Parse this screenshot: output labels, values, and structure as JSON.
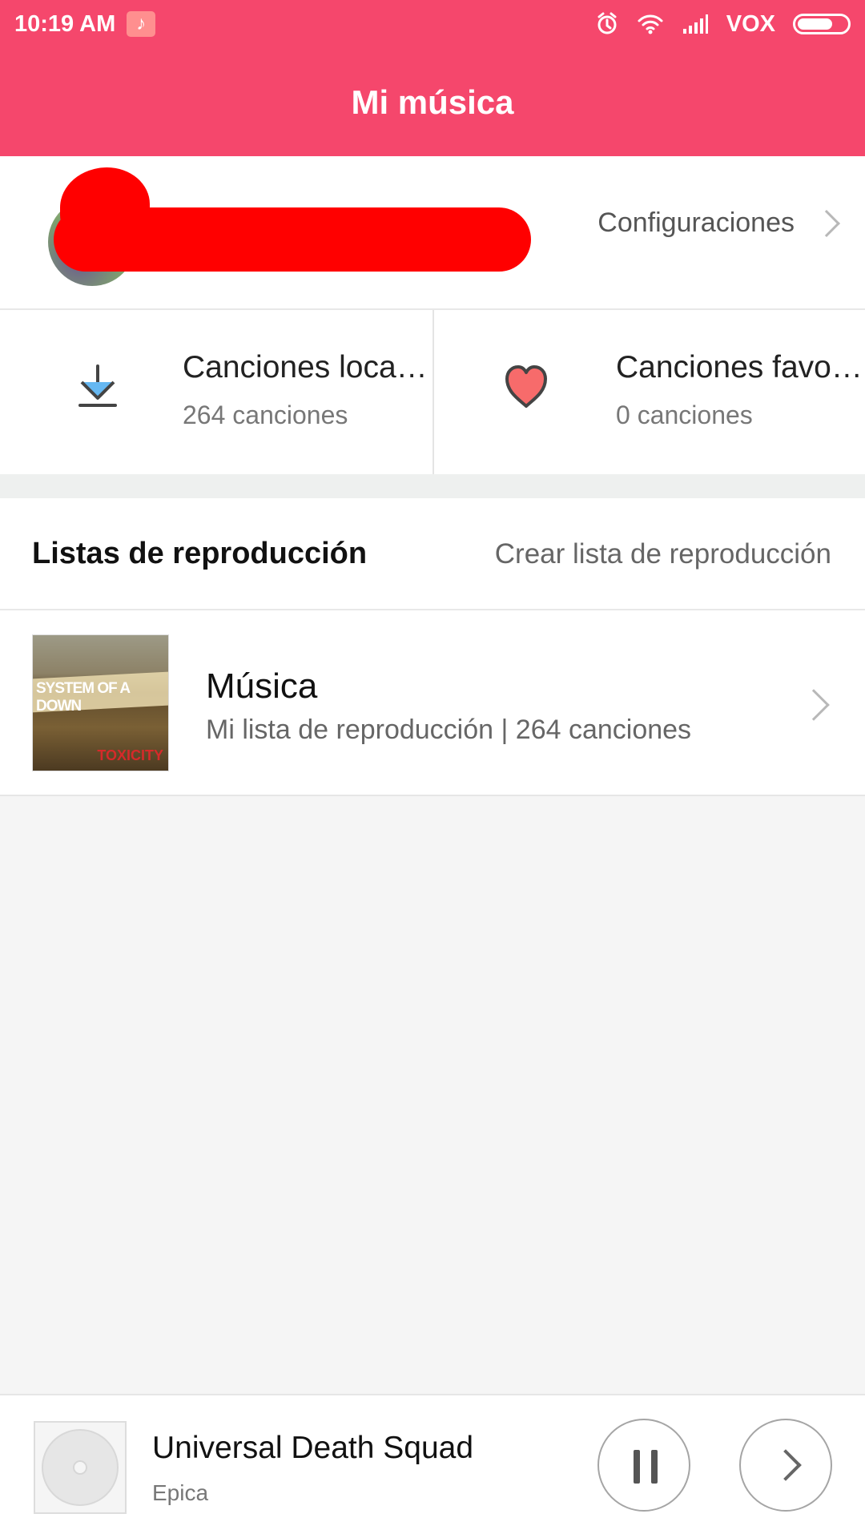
{
  "status_bar": {
    "time": "10:19 AM",
    "carrier": "VOX",
    "icons": [
      "music-notification-icon",
      "alarm-icon",
      "wifi-icon",
      "signal-icon",
      "battery-icon"
    ],
    "battery_level": 0.72
  },
  "header": {
    "title": "Mi música"
  },
  "profile": {
    "settings_label": "Configuraciones"
  },
  "shortcuts": [
    {
      "title": "Canciones locales",
      "count": "264 canciones",
      "icon": "download-icon"
    },
    {
      "title": "Canciones favoritas",
      "count": "0 canciones",
      "icon": "heart-icon"
    }
  ],
  "playlists": {
    "section_title": "Listas de reproducción",
    "create_label": "Crear lista de reproducción",
    "items": [
      {
        "name": "Música",
        "meta": "Mi lista de reproducción | 264 canciones",
        "cover_text": "SYSTEM OF A DOWN",
        "cover_subtitle": "TOXICITY"
      }
    ]
  },
  "player": {
    "song_title": "Universal Death Squad",
    "artist": "Epica",
    "controls": [
      "pause-icon",
      "next-icon"
    ]
  },
  "colors": {
    "accent": "#f5476c",
    "heart": "#f76b6b",
    "download_accent": "#66b8f2"
  }
}
